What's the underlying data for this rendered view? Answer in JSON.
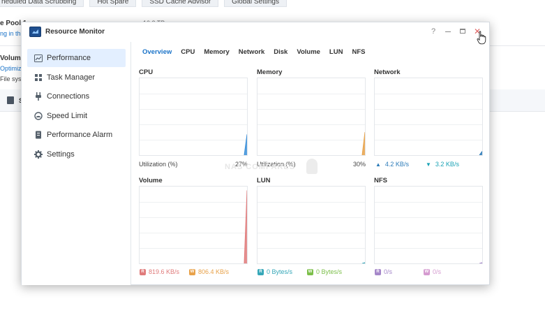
{
  "background": {
    "tabs": [
      "heduled Data Scrubbing",
      "Hot Spare",
      "SSD Cache Advisor",
      "Global Settings"
    ],
    "pool_label": "e Pool 1",
    "pool_status": "ng in th",
    "pool_size": "10.2 TB",
    "volume_label": "Volum",
    "volume_link": "Optimiz",
    "volume_fs": "File sys",
    "band_text": "S"
  },
  "window": {
    "title": "Resource Monitor",
    "controls": {
      "help": "?",
      "close": "✕"
    }
  },
  "sidebar": {
    "items": [
      {
        "label": "Performance",
        "icon": "performance-icon",
        "active": true
      },
      {
        "label": "Task Manager",
        "icon": "task-manager-icon"
      },
      {
        "label": "Connections",
        "icon": "connections-icon"
      },
      {
        "label": "Speed Limit",
        "icon": "speed-limit-icon"
      },
      {
        "label": "Performance Alarm",
        "icon": "alarm-icon"
      },
      {
        "label": "Settings",
        "icon": "gear-icon"
      }
    ]
  },
  "tabs": [
    "Overview",
    "CPU",
    "Memory",
    "Network",
    "Disk",
    "Volume",
    "LUN",
    "NFS"
  ],
  "active_tab": "Overview",
  "panels": {
    "cpu": {
      "title": "CPU",
      "caption": "Utilization  (%)",
      "value": "27%",
      "last_fraction": 0.27,
      "color": "#3a8fd9"
    },
    "memory": {
      "title": "Memory",
      "caption": "Utilization  (%)",
      "value": "30%",
      "last_fraction": 0.3,
      "color": "#e8a24a"
    },
    "network": {
      "title": "Network",
      "up": "4.2 KB/s",
      "down": "3.2 KB/s",
      "up_color": "#2a7ab8",
      "down_color": "#19a2b5"
    },
    "volume": {
      "title": "Volume",
      "read_badge": "R",
      "read": "819.6 KB/s",
      "write_badge": "W",
      "write": "806.4 KB/s",
      "read_color": "#e07b7b",
      "write_color": "#e8a24a",
      "last_fraction": 0.95
    },
    "lun": {
      "title": "LUN",
      "read_badge": "R",
      "read": "0 Bytes/s",
      "write_badge": "W",
      "write": "0 Bytes/s",
      "read_color": "#35a7b8",
      "write_color": "#7cbf4a"
    },
    "nfs": {
      "title": "NFS",
      "read_badge": "R",
      "read": "0/s",
      "write_badge": "W",
      "write": "0/s",
      "read_color": "#a587c9",
      "write_color": "#d59bd0"
    }
  },
  "watermark": "NAS COMPARES"
}
